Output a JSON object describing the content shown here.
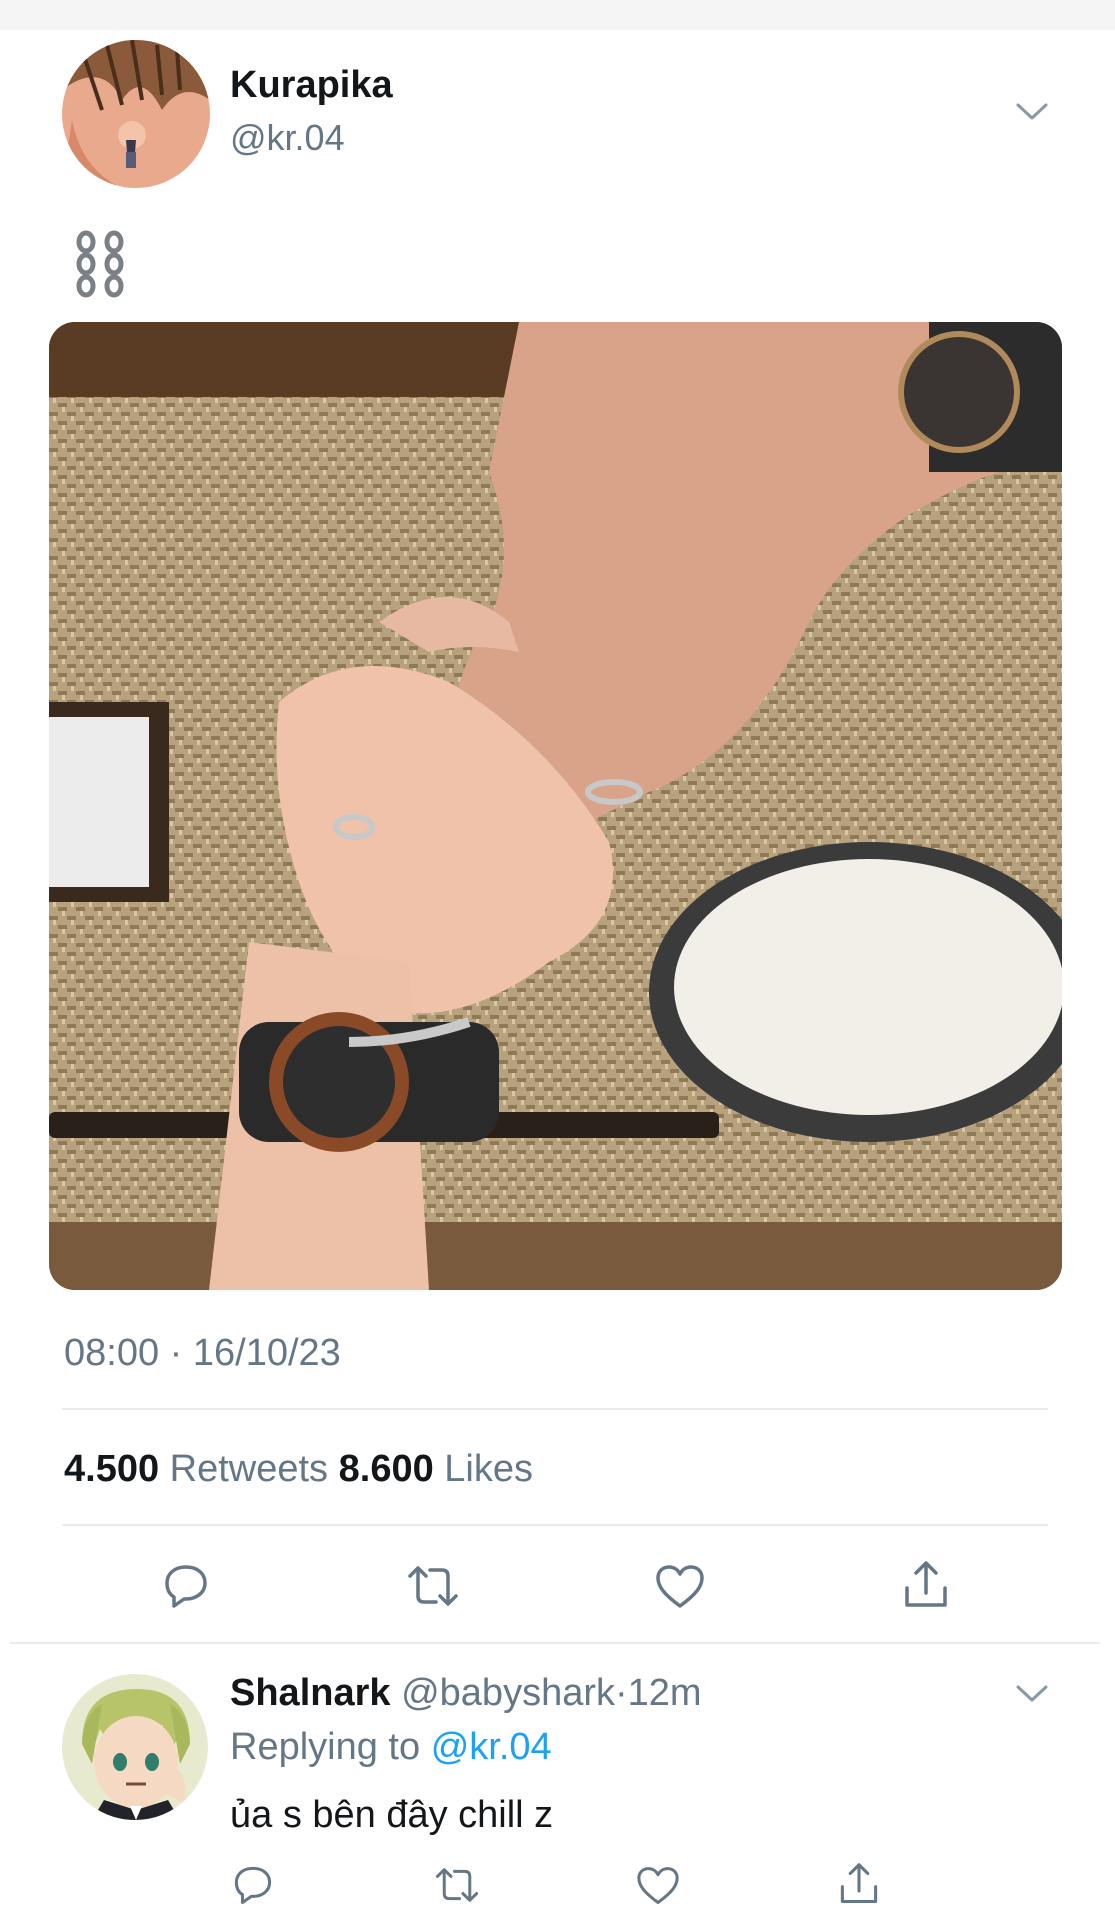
{
  "tweet": {
    "display_name": "Kurapika",
    "handle": "@kr.04",
    "emoji_icon": "chain-icon",
    "timestamp": "08:00 · 16/10/23",
    "stats": {
      "retweets_count": "4.500",
      "retweets_label": "Retweets",
      "likes_count": "8.600",
      "likes_label": "Likes"
    },
    "actions": [
      "reply-icon",
      "retweet-icon",
      "like-icon",
      "share-icon"
    ]
  },
  "reply": {
    "display_name": "Shalnark",
    "handle": "@babyshark",
    "separator": "·",
    "time": "12m",
    "replying_to_label": "Replying to",
    "replying_to_handle": "@kr.04",
    "text": "ủa s bên đây chill z",
    "actions": [
      "reply-icon",
      "retweet-icon",
      "like-icon",
      "share-icon"
    ]
  },
  "colors": {
    "text_primary": "#14171a",
    "text_secondary": "#657786",
    "link": "#1da1f2",
    "divider": "#e6ecf0"
  }
}
